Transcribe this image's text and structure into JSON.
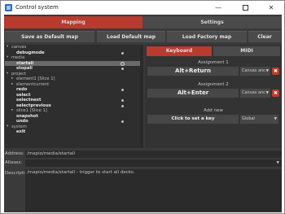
{
  "window": {
    "title": "Control system",
    "minimize": "—",
    "close": "✕"
  },
  "tabs": {
    "mapping": "Mapping",
    "settings": "Settings"
  },
  "toolbar": {
    "save_default": "Save as Default map",
    "load_default": "Load Default map",
    "load_factory": "Load Factory map",
    "clear_map": "Clear map..."
  },
  "tree": {
    "items": [
      {
        "label": "canvas",
        "kind": "group"
      },
      {
        "label": "debugmode",
        "kind": "bold"
      },
      {
        "label": "media",
        "kind": "group"
      },
      {
        "label": "startall",
        "kind": "bold"
      },
      {
        "label": "stopall",
        "kind": "bold"
      },
      {
        "label": "project",
        "kind": "group"
      },
      {
        "label": "element1 [Slice 1]",
        "kind": "group"
      },
      {
        "label": "elementcurrent",
        "kind": "group"
      },
      {
        "label": "redo",
        "kind": "bold"
      },
      {
        "label": "select",
        "kind": "bold"
      },
      {
        "label": "selectnext",
        "kind": "bold"
      },
      {
        "label": "selectprevious",
        "kind": "bold"
      },
      {
        "label": "slice1 [Slice 1]",
        "kind": "group"
      },
      {
        "label": "snapshot",
        "kind": "bold"
      },
      {
        "label": "undo",
        "kind": "bold"
      },
      {
        "label": "system",
        "kind": "group"
      },
      {
        "label": "exit",
        "kind": "bold"
      }
    ]
  },
  "right_panel": {
    "tab_keyboard": "Keyboard",
    "tab_midi": "MIDI",
    "assignments": [
      {
        "label": "Assignment 1",
        "key": "Alt+Return",
        "context": "Canvas anc"
      },
      {
        "label": "Assignment 2",
        "key": "Alt+Enter",
        "context": "Canvas anc"
      }
    ],
    "add_new_label": "Add new",
    "add_new_key": "Click to set a key",
    "add_new_context": "Global",
    "delete_glyph": "✖"
  },
  "fields": {
    "address_label": "Address:",
    "address_value": "/mapio/media/startall",
    "aliases_label": "Aliases:",
    "aliases_value": "",
    "description_label": "Description:",
    "description_value": "/mapio/media/startall - trigger to start all decks."
  },
  "colors": {
    "accent": "#b83b2e",
    "panel": "#3a3a3a"
  }
}
